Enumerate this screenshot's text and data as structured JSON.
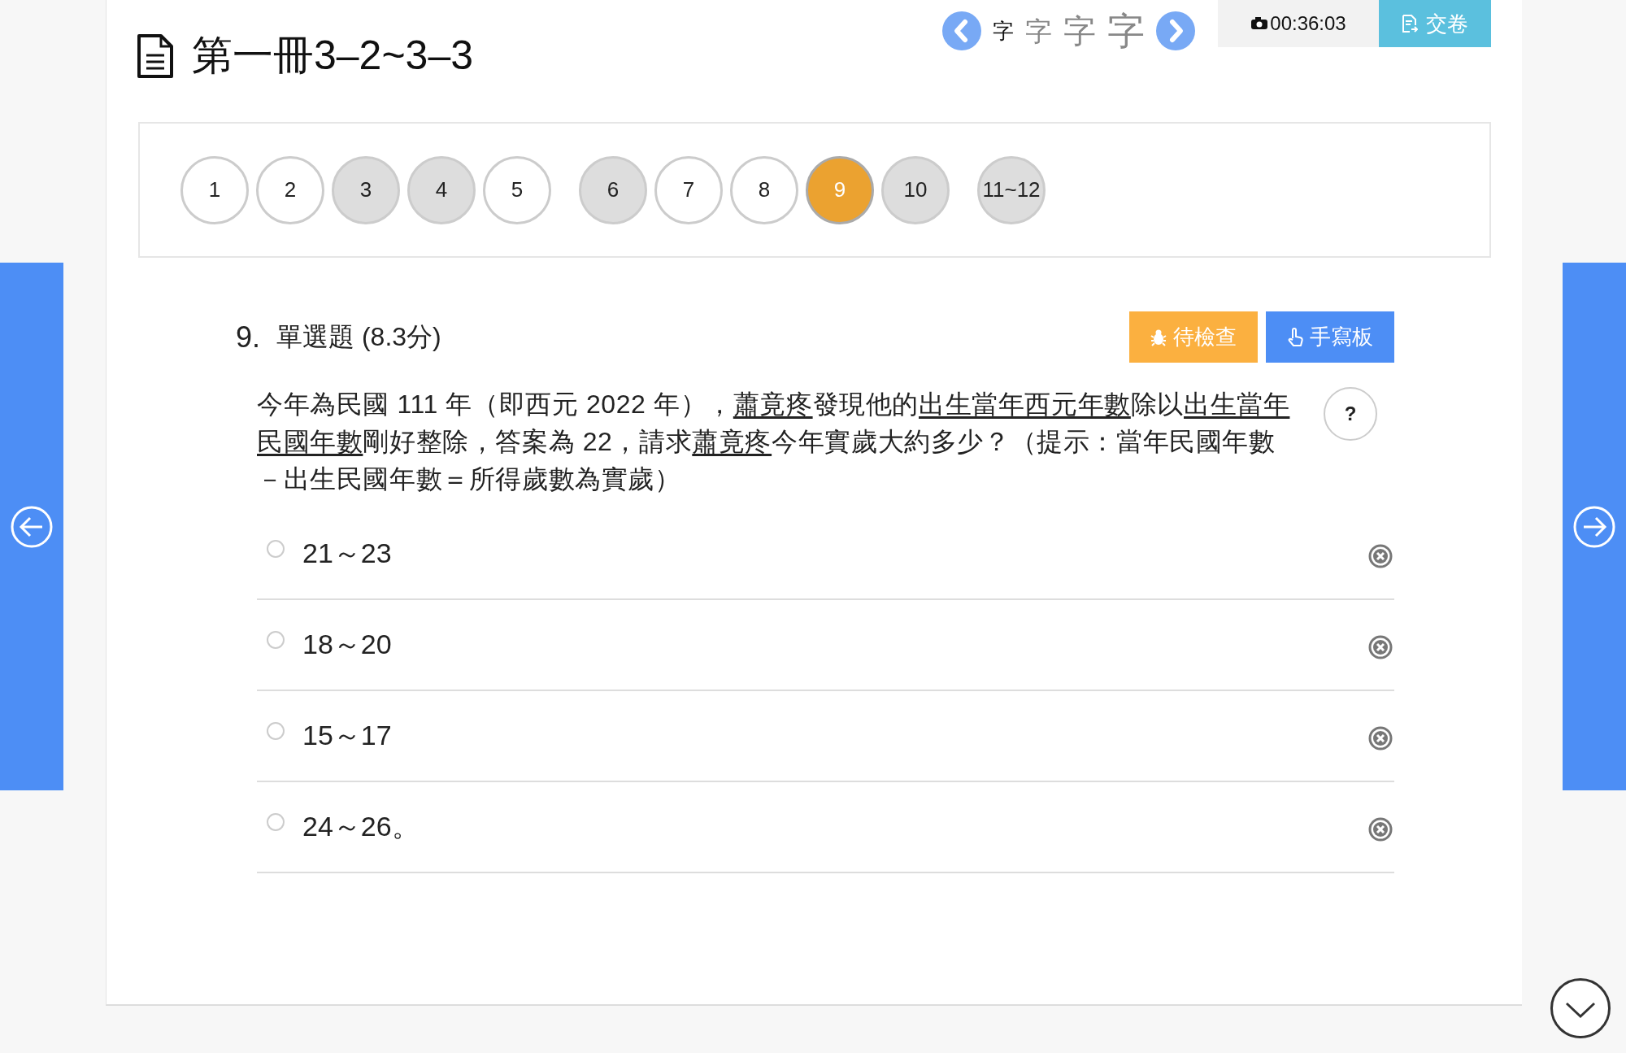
{
  "title": "第一冊3–2~3–3",
  "font_sizes": [
    {
      "label": "字",
      "selected": true
    },
    {
      "label": "字",
      "selected": false
    },
    {
      "label": "字",
      "selected": false
    },
    {
      "label": "字",
      "selected": false
    }
  ],
  "timer": "00:36:03",
  "submit_button": "交卷",
  "question_groups": [
    {
      "items": [
        {
          "label": "1",
          "answered": false,
          "selected": false
        },
        {
          "label": "2",
          "answered": false,
          "selected": false
        },
        {
          "label": "3",
          "answered": true,
          "selected": false
        },
        {
          "label": "4",
          "answered": true,
          "selected": false
        },
        {
          "label": "5",
          "answered": false,
          "selected": false
        }
      ]
    },
    {
      "items": [
        {
          "label": "6",
          "answered": true,
          "selected": false
        },
        {
          "label": "7",
          "answered": false,
          "selected": false
        },
        {
          "label": "8",
          "answered": false,
          "selected": false
        },
        {
          "label": "9",
          "answered": false,
          "selected": true
        },
        {
          "label": "10",
          "answered": true,
          "selected": false
        }
      ]
    },
    {
      "items": [
        {
          "label": "11~12",
          "answered": true,
          "selected": false
        }
      ]
    }
  ],
  "question": {
    "number": "9.",
    "type": "單選題 (8.3分)",
    "review_button": "待檢查",
    "handwriting_button": "手寫板",
    "help_button": "?",
    "text": [
      {
        "text": "今年為民國 111 年（即西元 2022 年），",
        "underline": false
      },
      {
        "text": "蕭竟疼",
        "underline": true
      },
      {
        "text": "發現他的",
        "underline": false
      },
      {
        "text": "出生當年西元年數",
        "underline": true
      },
      {
        "text": "除以",
        "underline": false
      },
      {
        "text": "出生當年民國年數",
        "underline": true
      },
      {
        "text": "剛好整除，答案為 22，請求",
        "underline": false
      },
      {
        "text": "蕭竟疼",
        "underline": true
      },
      {
        "text": "今年實歲大約多少？（提示：當年民國年數－出生民國年數＝所得歲數為實歲）",
        "underline": false
      }
    ],
    "options": [
      {
        "label": "21～23",
        "selected": false
      },
      {
        "label": "18～20",
        "selected": false
      },
      {
        "label": "15～17",
        "selected": false
      },
      {
        "label": "24～26。",
        "selected": false
      }
    ]
  }
}
